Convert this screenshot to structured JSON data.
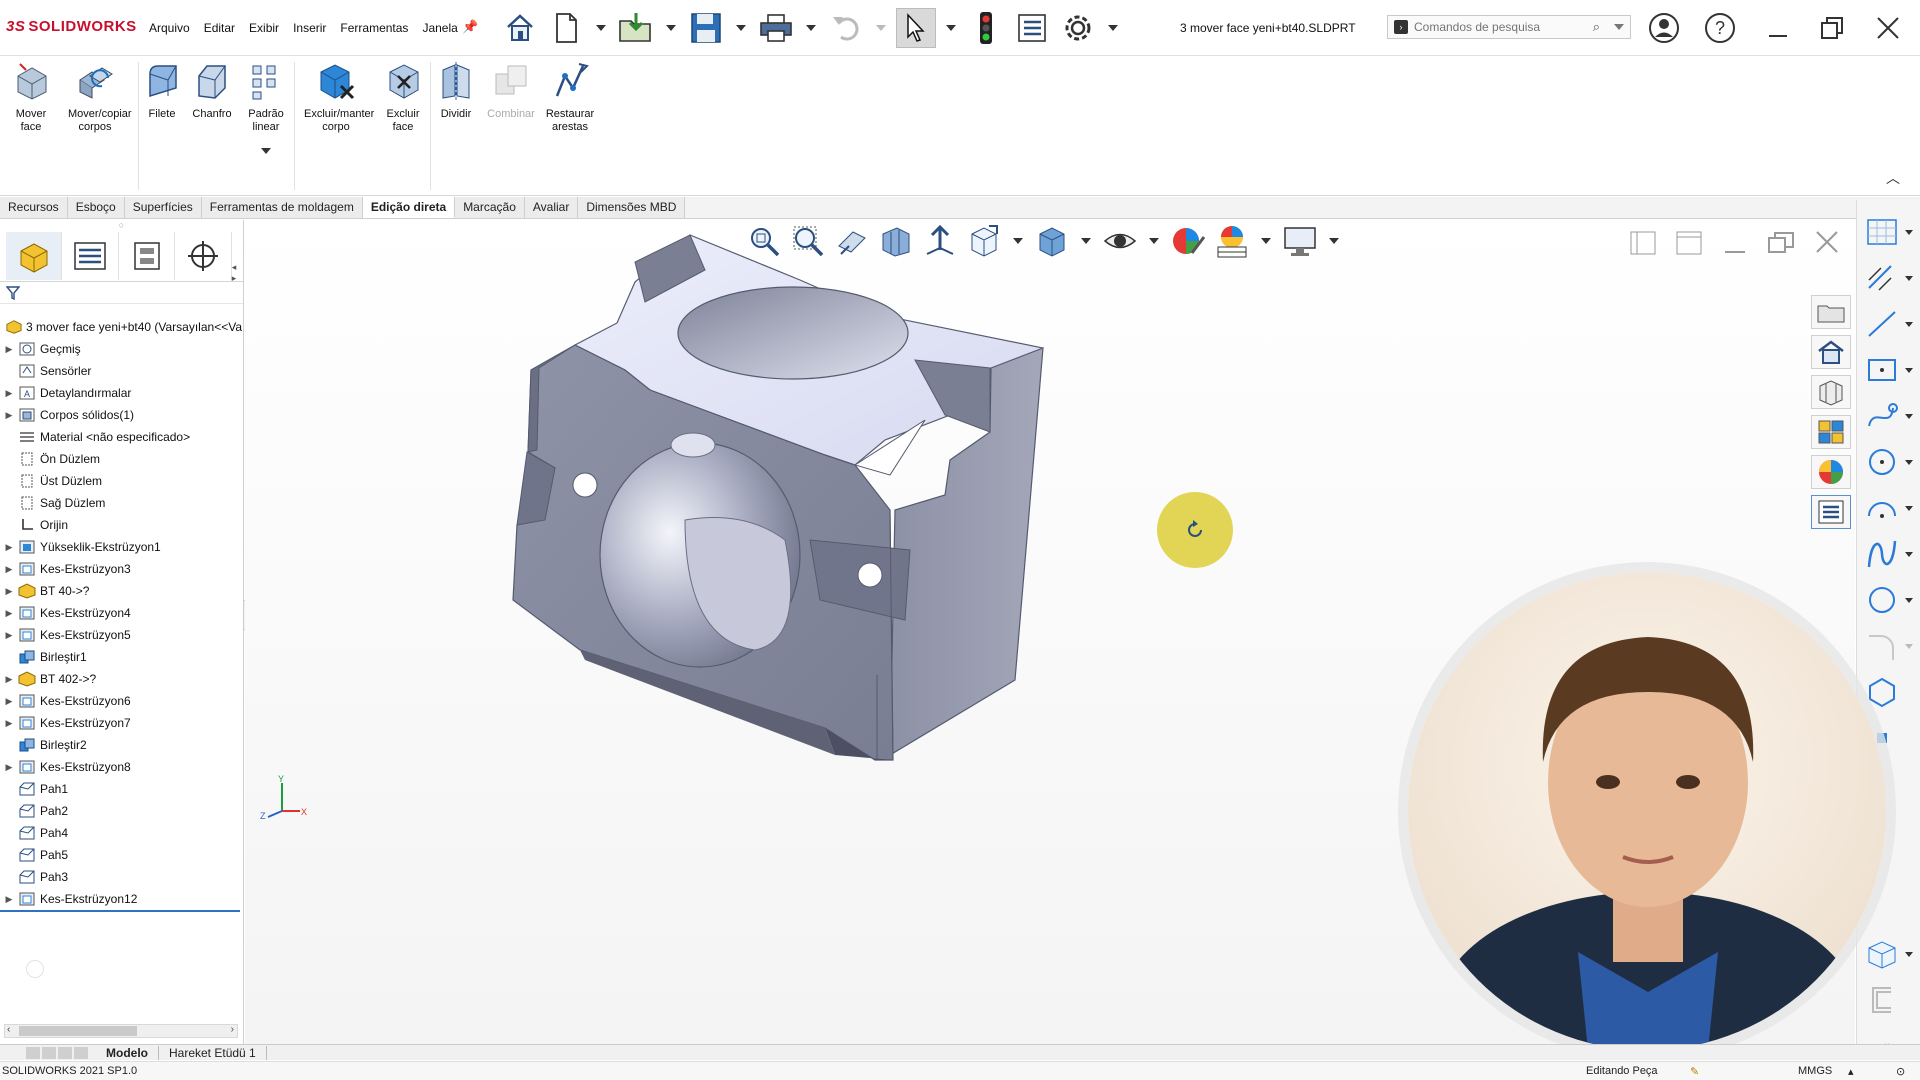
{
  "app": {
    "brand": "SOLIDWORKS",
    "brand_mark": "3S",
    "document_title": "3 mover face yeni+bt40.SLDPRT"
  },
  "menu": [
    "Arquivo",
    "Editar",
    "Exibir",
    "Inserir",
    "Ferramentas",
    "Janela"
  ],
  "search": {
    "placeholder": "Comandos de pesquisa"
  },
  "ribbon": {
    "buttons": [
      {
        "label": "Mover face"
      },
      {
        "label": "Mover/copiar corpos"
      },
      {
        "label": "Filete"
      },
      {
        "label": "Chanfro"
      },
      {
        "label": "Padrão linear"
      },
      {
        "label": "Excluir/manter corpo"
      },
      {
        "label": "Excluir face"
      },
      {
        "label": "Dividir"
      },
      {
        "label": "Combinar"
      },
      {
        "label": "Restaurar arestas"
      }
    ]
  },
  "tabs": [
    "Recursos",
    "Esboço",
    "Superfícies",
    "Ferramentas de moldagem",
    "Edição direta",
    "Marcação",
    "Avaliar",
    "Dimensões MBD"
  ],
  "active_tab": "Edição direta",
  "tree": {
    "root": "3 mover face yeni+bt40  (Varsayılan<<Va",
    "items": [
      {
        "label": "Geçmiş",
        "expandable": true,
        "icon": "history-icon"
      },
      {
        "label": "Sensörler",
        "expandable": false,
        "icon": "sensor-icon"
      },
      {
        "label": "Detaylandırmalar",
        "expandable": true,
        "icon": "annotation-icon"
      },
      {
        "label": "Corpos sólidos(1)",
        "expandable": true,
        "icon": "solid-bodies-icon"
      },
      {
        "label": "Material <não especificado>",
        "expandable": false,
        "icon": "material-icon"
      },
      {
        "label": "Ön Düzlem",
        "expandable": false,
        "icon": "plane-icon"
      },
      {
        "label": "Üst Düzlem",
        "expandable": false,
        "icon": "plane-icon"
      },
      {
        "label": "Sağ Düzlem",
        "expandable": false,
        "icon": "plane-icon"
      },
      {
        "label": "Orijin",
        "expandable": false,
        "icon": "origin-icon"
      },
      {
        "label": "Yükseklik-Ekstrüzyon1",
        "expandable": true,
        "icon": "extrude-icon"
      },
      {
        "label": "Kes-Ekstrüzyon3",
        "expandable": true,
        "icon": "cut-extrude-icon"
      },
      {
        "label": "BT 40->?",
        "expandable": true,
        "icon": "imported-part-icon"
      },
      {
        "label": "Kes-Ekstrüzyon4",
        "expandable": true,
        "icon": "cut-extrude-icon"
      },
      {
        "label": "Kes-Ekstrüzyon5",
        "expandable": true,
        "icon": "cut-extrude-icon"
      },
      {
        "label": "Birleştir1",
        "expandable": false,
        "icon": "combine-icon"
      },
      {
        "label": "BT 402->?",
        "expandable": true,
        "icon": "imported-part-icon"
      },
      {
        "label": "Kes-Ekstrüzyon6",
        "expandable": true,
        "icon": "cut-extrude-icon"
      },
      {
        "label": "Kes-Ekstrüzyon7",
        "expandable": true,
        "icon": "cut-extrude-icon"
      },
      {
        "label": "Birleştir2",
        "expandable": false,
        "icon": "combine-icon"
      },
      {
        "label": "Kes-Ekstrüzyon8",
        "expandable": true,
        "icon": "cut-extrude-icon"
      },
      {
        "label": "Pah1",
        "expandable": false,
        "icon": "chamfer-icon"
      },
      {
        "label": "Pah2",
        "expandable": false,
        "icon": "chamfer-icon"
      },
      {
        "label": "Pah4",
        "expandable": false,
        "icon": "chamfer-icon"
      },
      {
        "label": "Pah5",
        "expandable": false,
        "icon": "chamfer-icon"
      },
      {
        "label": "Pah3",
        "expandable": false,
        "icon": "chamfer-icon"
      },
      {
        "label": "Kes-Ekstrüzyon12",
        "expandable": true,
        "icon": "cut-extrude-icon"
      }
    ]
  },
  "bottom_tabs": [
    "Modelo",
    "Hareket Etüdü 1"
  ],
  "active_bottom_tab": "Modelo",
  "status": {
    "version": "SOLIDWORKS 2021 SP1.0",
    "mode": "Editando Peça",
    "units": "MMGS"
  },
  "triad": {
    "x": "X",
    "y": "Y",
    "z": "Z"
  },
  "colors": {
    "brand": "#c8102e",
    "model": "#8a8ea6",
    "accent": "#2f72c4"
  }
}
